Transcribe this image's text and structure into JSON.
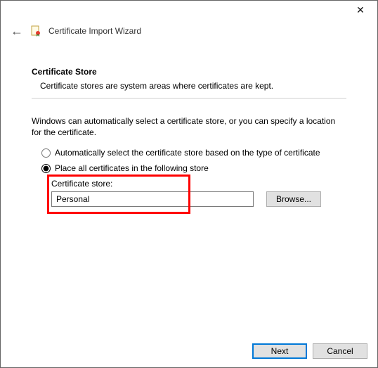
{
  "header": {
    "title": "Certificate Import Wizard"
  },
  "section": {
    "heading": "Certificate Store",
    "subtext": "Certificate stores are system areas where certificates are kept."
  },
  "body": {
    "intro": "Windows can automatically select a certificate store, or you can specify a location for the certificate.",
    "option_auto": "Automatically select the certificate store based on the type of certificate",
    "option_place": "Place all certificates in the following store",
    "store_label": "Certificate store:",
    "store_value": "Personal",
    "browse_label": "Browse..."
  },
  "footer": {
    "next": "Next",
    "cancel": "Cancel"
  }
}
